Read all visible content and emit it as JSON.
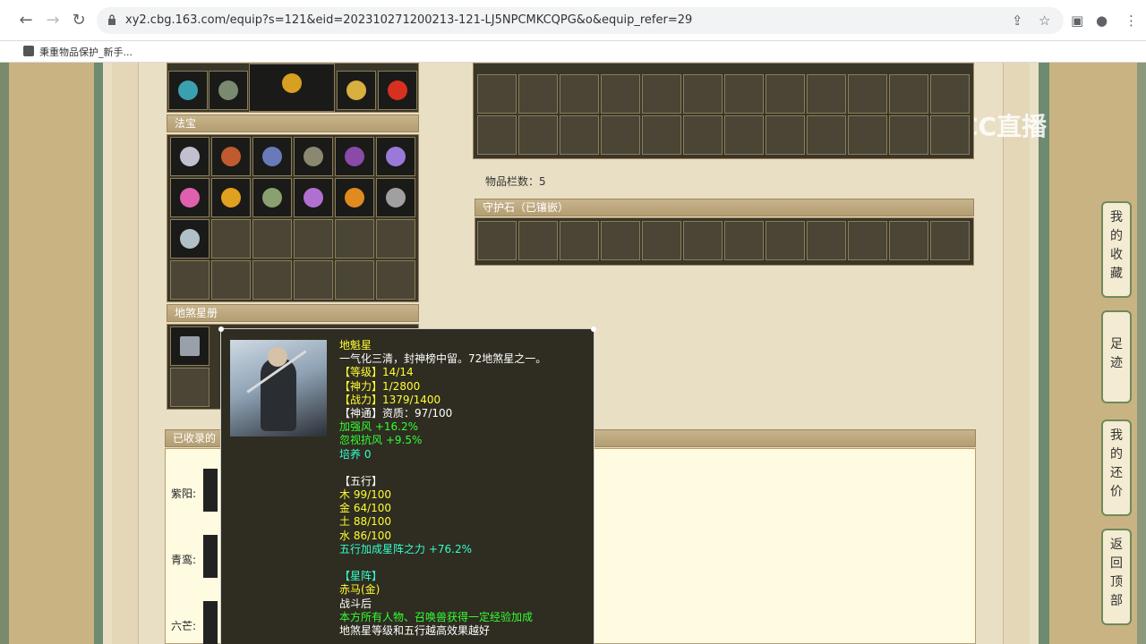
{
  "browser": {
    "url": "xy2.cbg.163.com/equip?s=121&eid=202310271200213-121-LJ5NPCMKCQPG&o&equip_refer=29",
    "bookmark": "秉重物品保护_新手...",
    "watermark": "CC直播"
  },
  "sections": {
    "fabao_title": "法宝",
    "disha_title": "地煞星册",
    "guard_title": "守护石（已镶嵌）",
    "collected_title": "已收录的",
    "item_count": "物品栏数：5"
  },
  "collected_rows": [
    {
      "label": "紫阳:"
    },
    {
      "label": "青鸾:"
    },
    {
      "label": "六芒:"
    }
  ],
  "tooltip": {
    "name": "地魁星",
    "desc": "一气化三清，封神榜中留。72地煞星之一。",
    "level": "【等级】14/14",
    "shenli": "【神力】1/2800",
    "zhanli": "【战力】1379/1400",
    "shentong": "【神通】资质：97/100",
    "attr1": "加强风 +16.2%",
    "attr2": "忽视抗风 +9.5%",
    "peiyang": "培养 0",
    "wuxing_title": "【五行】",
    "mu": "木 99/100",
    "jin": "金 64/100",
    "tu": "土 88/100",
    "shui": "水 86/100",
    "wuxing_bonus": "五行加成星阵之力 +76.2%",
    "xingzhen_title": "【星阵】",
    "xingzhen_name": "赤马(金)",
    "trigger": "战斗后",
    "effect": "本方所有人物、召唤兽获得一定经验加成",
    "note": "地煞星等级和五行越高效果越好"
  },
  "side_tabs": {
    "fav": "我的收藏",
    "footprint": "足迹",
    "bargain": "我的还价",
    "top": "返回顶部"
  },
  "colors": {
    "tooltip_bg": "#2f2c21",
    "yellow": "#ffff33",
    "green": "#33ff33",
    "cyan": "#33ffcc"
  }
}
